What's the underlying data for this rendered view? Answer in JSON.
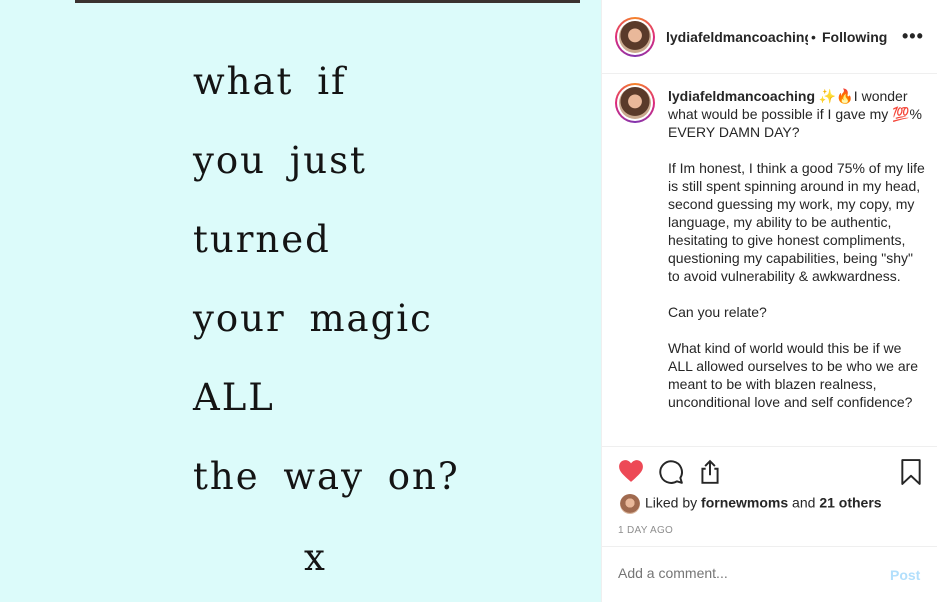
{
  "image": {
    "poem_lines": [
      "what if",
      "you just",
      "turned",
      "your magic",
      "ALL",
      "the way on?"
    ],
    "signoff": "x"
  },
  "header": {
    "username": "lydiafeldmancoaching",
    "separator": "•",
    "follow_status": "Following",
    "more": "•••"
  },
  "caption": {
    "username": "lydiafeldmancoaching",
    "lead": " ✨🔥I wonder what would be possible if I gave my 💯% EVERY DAMN DAY?",
    "paragraphs": [
      "If Im honest, I think a good 75% of my life is still spent spinning around in my head, second guessing my work, my copy, my language, my ability to be authentic, hesitating to give honest compliments, questioning my capabilities, being \"shy\" to avoid vulnerability & awkwardness.",
      "Can you relate?",
      "What kind of world would this be if we ALL allowed ourselves to be who we are meant to be with blazen realness, unconditional love and self confidence?"
    ]
  },
  "likes": {
    "prefix": "Liked by ",
    "first_user": "fornewmoms",
    "and": " and ",
    "others": "21 others"
  },
  "timestamp": "1 DAY AGO",
  "comment": {
    "placeholder": "Add a comment...",
    "post_label": "Post"
  },
  "colors": {
    "image_bg": "#dcfbfa",
    "liked_heart": "#ed4956",
    "post_disabled": "#b2dffc"
  },
  "icons": {
    "like": "heart-icon",
    "comment": "comment-icon",
    "share": "share-icon",
    "save": "bookmark-icon",
    "more": "more-options-icon"
  }
}
